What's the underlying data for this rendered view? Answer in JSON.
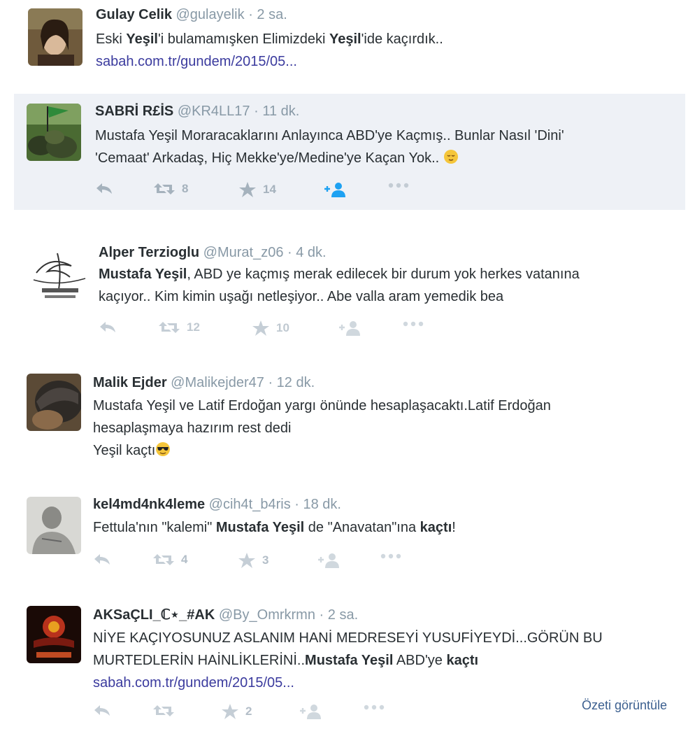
{
  "tweets": [
    {
      "name": "Gulay Celik",
      "handle": "@gulayelik",
      "time": "2 sa.",
      "lines": [
        [
          {
            "t": "Eski "
          },
          {
            "t": "Yeşil",
            "b": true
          },
          {
            "t": "'i bulamamışken Elimizdeki "
          },
          {
            "t": "Yeşil",
            "b": true
          },
          {
            "t": "'ide kaçırdık.."
          }
        ]
      ],
      "link": "sabah.com.tr/gundem/2015/05..."
    },
    {
      "name": "SABRİ R£İS",
      "handle": "@KR4LL17",
      "time": "11 dk.",
      "lines": [
        [
          {
            "t": "Mustafa Yeşil Moraracaklarını Anlayınca ABD'ye Kaçmış.. Bunlar Nasıl 'Dini'"
          }
        ],
        [
          {
            "t": "'Cemaat' Arkadaş, Hiç Mekke'ye/Medine'ye Kaçan Yok.. "
          }
        ]
      ],
      "retweets": "8",
      "favorites": "14"
    },
    {
      "name": "Alper Terzioglu",
      "handle": "@Murat_z06",
      "time": "4 dk.",
      "lines": [
        [
          {
            "t": "Mustafa Yeşil",
            "b": true
          },
          {
            "t": ",  ABD ye kaçmış merak edilecek bir durum yok herkes vatanına"
          }
        ],
        [
          {
            "t": "kaçıyor.. Kim kimin uşağı netleşiyor.. Abe valla aram yemedik bea"
          }
        ]
      ],
      "retweets": "12",
      "favorites": "10"
    },
    {
      "name": "Malik Ejder",
      "handle": "@Malikejder47",
      "time": "12 dk.",
      "lines": [
        [
          {
            "t": "Mustafa Yeşil ve Latif Erdoğan yargı önünde hesaplaşacaktı.Latif Erdoğan"
          }
        ],
        [
          {
            "t": "hesaplaşmaya hazırım rest dedi"
          }
        ],
        [
          {
            "t": "Yeşil kaçtı"
          }
        ]
      ]
    },
    {
      "name": "kel4md4nk4leme",
      "handle": "@cih4t_b4ris",
      "time": "18 dk.",
      "lines": [
        [
          {
            "t": "Fettula'nın \"kalemi\" "
          },
          {
            "t": "Mustafa Yeşil",
            "b": true
          },
          {
            "t": " de \"Anavatan\"ına "
          },
          {
            "t": "kaçtı",
            "b": true
          },
          {
            "t": "!"
          }
        ]
      ],
      "retweets": "4",
      "favorites": "3"
    },
    {
      "name": "AKSaÇLI_ℂ⋆_#AK",
      "handle": "@By_Omrkrmn",
      "time": "2 sa.",
      "lines": [
        [
          {
            "t": "NİYE KAÇIYOSUNUZ ASLANIM HANİ MEDRESEYİ YUSUFİYEYDİ...GÖRÜN BU"
          }
        ],
        [
          {
            "t": "MURTEDLERİN HAİNLİKLERİNİ.."
          },
          {
            "t": "Mustafa Yeşil",
            "b": true
          },
          {
            "t": " ABD'ye "
          },
          {
            "t": "kaçtı",
            "b": true
          }
        ]
      ],
      "link": "sabah.com.tr/gundem/2015/05...",
      "favorites": "2",
      "summary_label": "Özeti görüntüle"
    }
  ],
  "dot": "·"
}
